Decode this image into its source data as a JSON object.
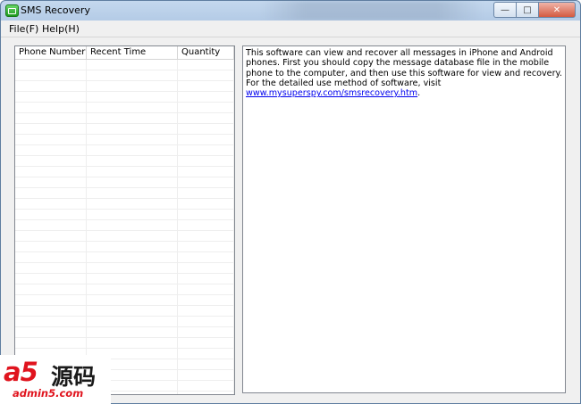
{
  "window": {
    "title": "SMS Recovery",
    "controls": {
      "minimize": "—",
      "maximize": "□",
      "close": "✕"
    }
  },
  "menu": [
    {
      "label": "File(F)"
    },
    {
      "label": "Help(H)"
    }
  ],
  "list": {
    "columns": [
      "Phone Number",
      "Recent Time",
      "Quantity"
    ],
    "rows": []
  },
  "info": {
    "text": "This software can view and recover all messages in iPhone and Android phones. First you should copy the message database file in the mobile phone to the computer, and then use this software for view and recovery. For the detailed use method of software, visit ",
    "link": "www.mysuperspy.com/smsrecovery.htm",
    "suffix": "."
  },
  "watermark": {
    "logo": "a5",
    "cn": "源码",
    "url": "admin5.com"
  },
  "colors": {
    "watermark_red": "#e0141e",
    "link": "#0000ee"
  }
}
